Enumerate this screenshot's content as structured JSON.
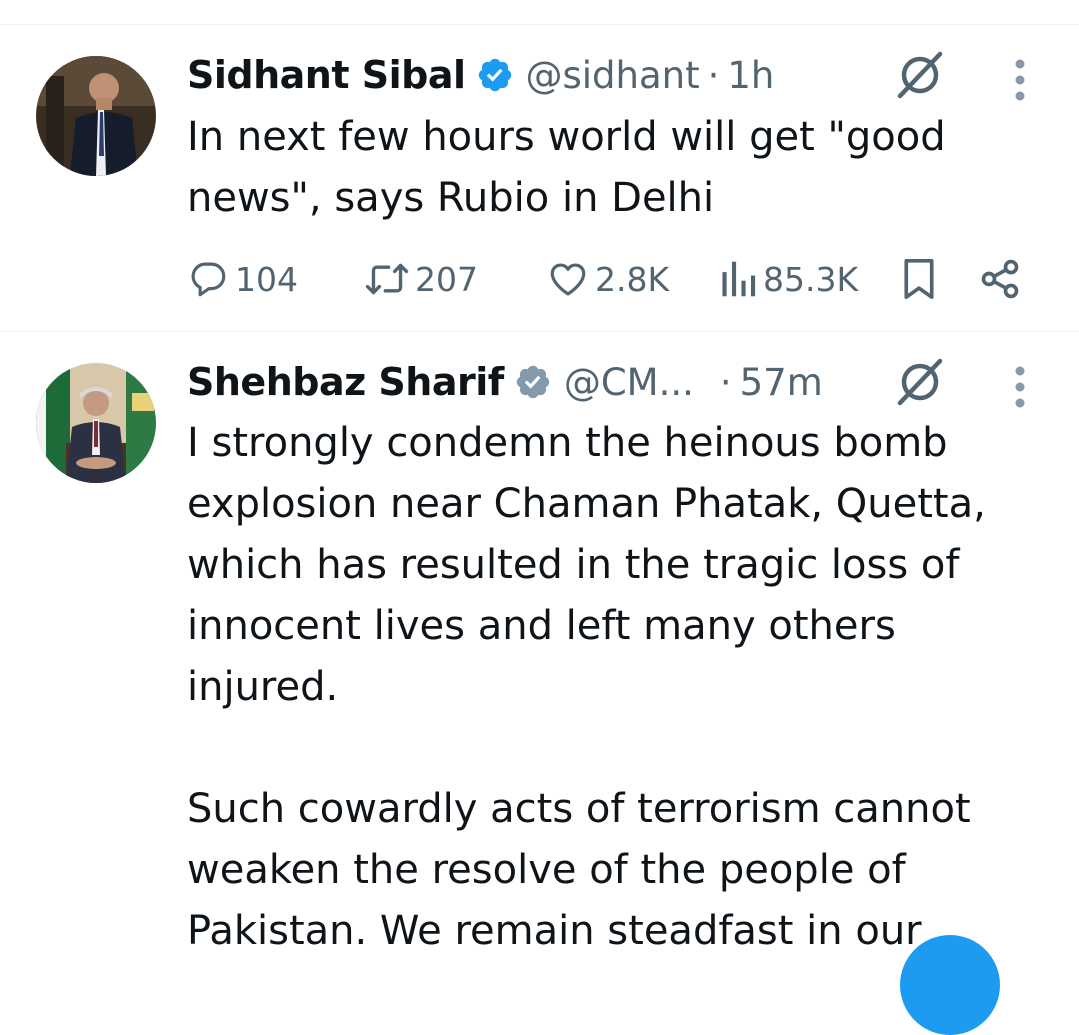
{
  "colors": {
    "accent": "#1d9bf0",
    "muted": "#536471",
    "text": "#0f1419",
    "gray_badge": "#829aab",
    "divider": "#eff3f4"
  },
  "tweets": [
    {
      "author": "Sidhant Sibal",
      "handle": "@sidhant",
      "separator": "·",
      "time": "1h",
      "badge": "verified-blue-icon",
      "text": "In next few hours world will get \"good\nnews\", says Rubio in Delhi",
      "stats": {
        "replies": "104",
        "reposts": "207",
        "likes": "2.8K",
        "views": "85.3K"
      }
    },
    {
      "author": "Shehbaz Sharif",
      "handle": "@CM...",
      "separator": "·",
      "time": "57m",
      "badge": "verified-gray-icon",
      "text": "I strongly condemn the heinous bomb\nexplosion near Chaman Phatak, Quetta,\nwhich has resulted in the tragic loss of\ninnocent lives and left many others\ninjured.\n\nSuch cowardly acts of terrorism cannot\nweaken the resolve of the people of\nPakistan. We remain steadfast in our"
    }
  ],
  "icons": {
    "grok": "grok-icon",
    "more": "more-options-icon",
    "bookmark": "bookmark-icon",
    "share": "share-icon"
  }
}
